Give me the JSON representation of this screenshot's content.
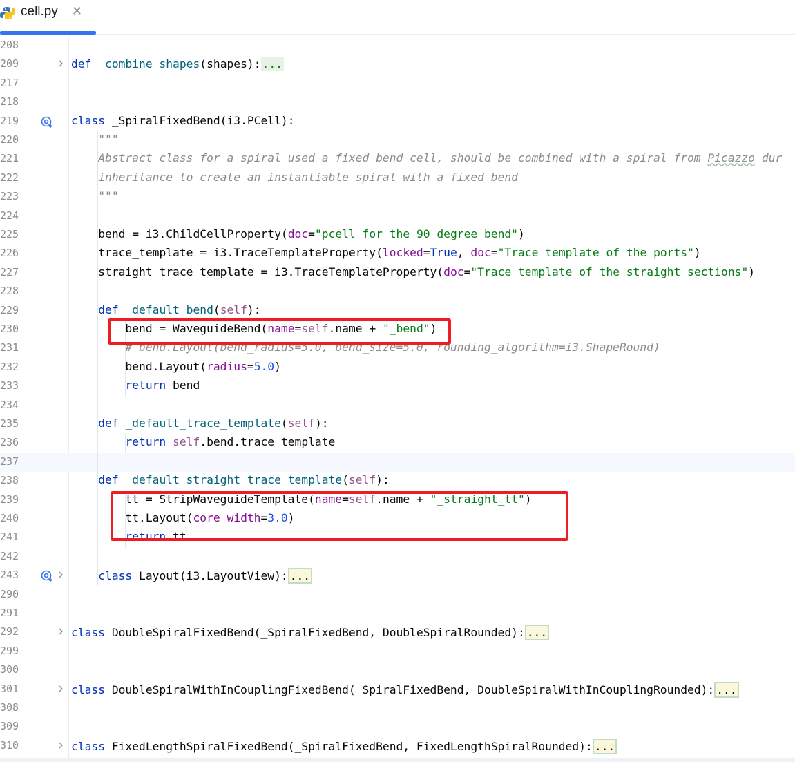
{
  "tab": {
    "title": "cell.py",
    "close": "✕",
    "icon": "python-file-icon"
  },
  "lines": [
    {
      "n": "208"
    },
    {
      "n": "209",
      "fold": "chevron",
      "code": "def_combine"
    },
    {
      "n": "217"
    },
    {
      "n": "218"
    },
    {
      "n": "219",
      "gicon": "override-icon",
      "code": "class_spiral"
    },
    {
      "n": "220",
      "code": "doc_open"
    },
    {
      "n": "221",
      "code": "doc_1"
    },
    {
      "n": "222",
      "code": "doc_2"
    },
    {
      "n": "223",
      "code": "doc_close"
    },
    {
      "n": "224"
    },
    {
      "n": "225",
      "code": "bend_prop"
    },
    {
      "n": "226",
      "code": "trace_prop"
    },
    {
      "n": "227",
      "code": "straight_prop"
    },
    {
      "n": "228"
    },
    {
      "n": "229",
      "code": "def_default_bend"
    },
    {
      "n": "230",
      "code": "bend_assign"
    },
    {
      "n": "231",
      "code": "bend_comment"
    },
    {
      "n": "232",
      "code": "bend_layout"
    },
    {
      "n": "233",
      "code": "return_bend"
    },
    {
      "n": "234"
    },
    {
      "n": "235",
      "code": "def_default_trace"
    },
    {
      "n": "236",
      "code": "return_trace"
    },
    {
      "n": "237",
      "current": true
    },
    {
      "n": "238",
      "code": "def_default_straight"
    },
    {
      "n": "239",
      "code": "tt_assign"
    },
    {
      "n": "240",
      "code": "tt_layout"
    },
    {
      "n": "241",
      "code": "return_tt"
    },
    {
      "n": "242"
    },
    {
      "n": "243",
      "gicon": "override-icon",
      "fold": "chevron",
      "code": "class_layout"
    },
    {
      "n": "290"
    },
    {
      "n": "291"
    },
    {
      "n": "292",
      "fold": "chevron",
      "code": "class_double"
    },
    {
      "n": "299"
    },
    {
      "n": "300"
    },
    {
      "n": "301",
      "fold": "chevron",
      "code": "class_double_coupling"
    },
    {
      "n": "308"
    },
    {
      "n": "309"
    },
    {
      "n": "310",
      "fold": "chevron",
      "code": "class_fixed_length"
    }
  ],
  "code": {
    "def_combine": {
      "kw": "def",
      "name": "_combine_shapes",
      "args": "(shapes):",
      "fold": "..."
    },
    "class_spiral": {
      "kw": "class",
      "name": "_SpiralFixedBend",
      "bases": "(i3.PCell):"
    },
    "doc_open": "\"\"\"",
    "doc_1a": "Abstract class for a spiral used a fixed bend cell, should be combined with a spiral from ",
    "doc_1b": "Picazzo",
    "doc_1c": " dur",
    "doc_2": "inheritance to create an instantiable spiral with a fixed bend",
    "doc_close": "\"\"\"",
    "bend_prop": {
      "lhs": "bend = i3.ChildCellProperty(",
      "param": "doc",
      "eq": "=",
      "str": "\"pcell for the 90 degree bend\"",
      "end": ")"
    },
    "trace_prop": {
      "lhs": "trace_template = i3.TraceTemplateProperty(",
      "p1": "locked",
      "eq": "=",
      "v1": "True",
      "sep": ", ",
      "p2": "doc",
      "str": "\"Trace template of the ports\"",
      "end": ")"
    },
    "straight_prop": {
      "lhs": "straight_trace_template = i3.TraceTemplateProperty(",
      "param": "doc",
      "eq": "=",
      "str": "\"Trace template of the straight sections\"",
      "end": ")"
    },
    "def_default_bend": {
      "kw": "def",
      "name": "_default_bend",
      "open": "(",
      "self": "self",
      "close": "):"
    },
    "bend_assign": {
      "lhs": "bend = WaveguideBend(",
      "param": "name",
      "eq": "=",
      "self": "self",
      "mid": ".name + ",
      "str": "\"_bend\"",
      "end": ")"
    },
    "bend_comment": "# bend.Layout(bend_radius=5.0, bend_size=5.0, rounding_algorithm=i3.ShapeRound)",
    "bend_layout": {
      "lhs": "bend.Layout(",
      "param": "radius",
      "eq": "=",
      "num": "5.0",
      "end": ")"
    },
    "return_bend": {
      "kw": "return",
      "rest": " bend"
    },
    "def_default_trace": {
      "kw": "def",
      "name": "_default_trace_template",
      "open": "(",
      "self": "self",
      "close": "):"
    },
    "return_trace": {
      "kw": "return",
      "self": "self",
      "rest": ".bend.trace_template"
    },
    "def_default_straight": {
      "kw": "def",
      "name": "_default_straight_trace_template",
      "open": "(",
      "self": "self",
      "close": "):"
    },
    "tt_assign": {
      "lhs": "tt = StripWaveguideTemplate(",
      "param": "name",
      "eq": "=",
      "self": "self",
      "mid": ".name + ",
      "str": "\"_straight_tt\"",
      "end": ")"
    },
    "tt_layout": {
      "lhs": "tt.Layout(",
      "param": "core_width",
      "eq": "=",
      "num": "3.0",
      "end": ")"
    },
    "return_tt": {
      "kw": "return",
      "rest": " tt"
    },
    "class_layout": {
      "kw": "class",
      "name": " Layout(i3.LayoutView):",
      "fold": "..."
    },
    "class_double": {
      "kw": "class",
      "name": " DoubleSpiralFixedBend(_SpiralFixedBend, DoubleSpiralRounded):",
      "fold": "..."
    },
    "class_double_coupling": {
      "kw": "class",
      "name": " DoubleSpiralWithInCouplingFixedBend(_SpiralFixedBend, DoubleSpiralWithInCouplingRounded):",
      "fold": "..."
    },
    "class_fixed_length": {
      "kw": "class",
      "name": " FixedLengthSpiralFixedBend(_SpiralFixedBend, FixedLengthSpiralRounded):",
      "fold": "..."
    }
  },
  "colors": {
    "keyword": "#0033b3",
    "function": "#00627a",
    "string": "#067d17",
    "comment": "#8c8c8c",
    "param": "#871094",
    "self": "#94558d",
    "number": "#1750eb",
    "highlight_box": "#ee1c25",
    "tab_accent": "#3574f0"
  }
}
